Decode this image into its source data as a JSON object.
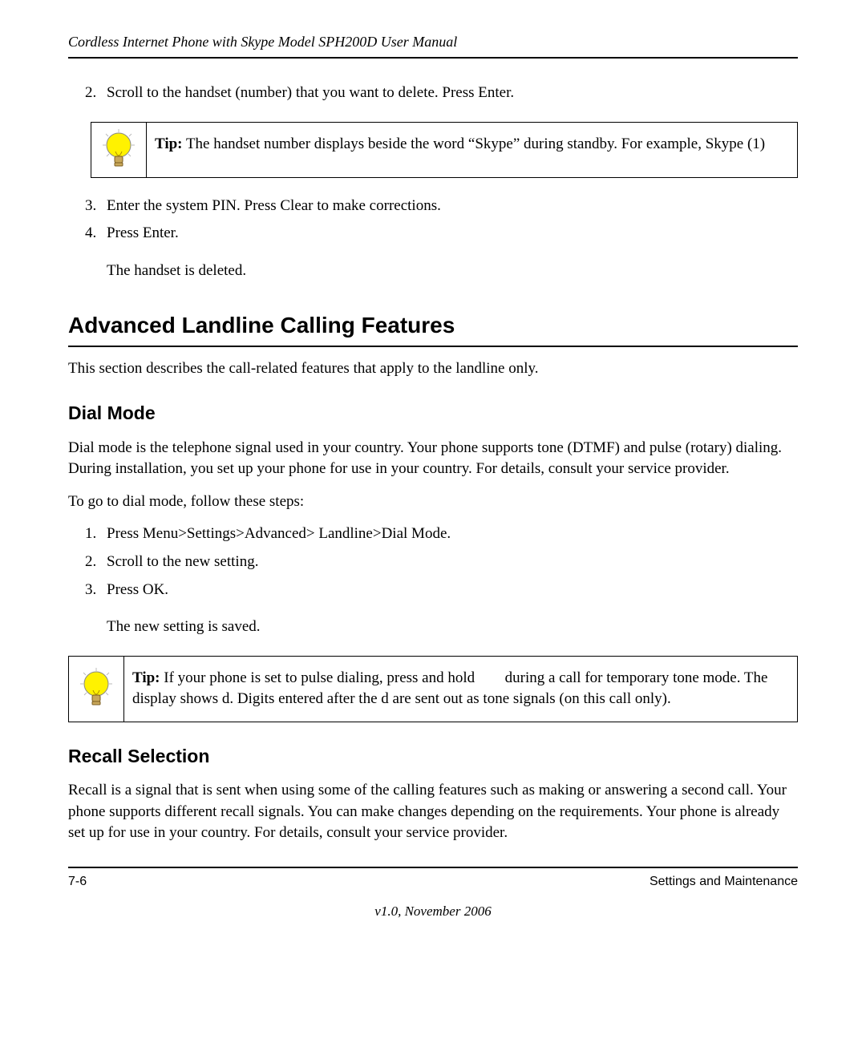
{
  "header": "Cordless Internet Phone with Skype Model SPH200D User Manual",
  "steps_a": {
    "start": 2,
    "items": [
      "Scroll to the handset (number) that you want to delete. Press Enter."
    ]
  },
  "tip1": {
    "label": "Tip:",
    "text": "The handset number displays beside the word “Skype” during standby. For example, Skype (1)"
  },
  "steps_b": {
    "start": 3,
    "items": [
      "Enter the system PIN. Press Clear to make corrections.",
      "Press Enter."
    ]
  },
  "result_b": "The handset is deleted.",
  "h1": "Advanced Landline Calling Features",
  "intro": "This section describes the call-related features that apply to the landline only.",
  "h2a": "Dial Mode",
  "dialmode_p": "Dial mode is the telephone signal used in your country. Your phone supports tone (DTMF) and pulse (rotary) dialing. During installation, you set up your phone for use in your country. For details, consult your service provider.",
  "dialmode_lead": "To go to dial mode, follow these steps:",
  "steps_c": {
    "start": 1,
    "items": [
      "Press Menu>Settings>Advanced> Landline>Dial Mode.",
      "Scroll to the new setting.",
      "Press OK."
    ]
  },
  "result_c": "The new setting is saved.",
  "tip2": {
    "label": "Tip:",
    "text_a": "If your phone is set to pulse dialing, press and hold ",
    "text_b": " during a call for temporary tone mode. The display shows d. Digits entered after the d are sent out as tone signals (on this call only)."
  },
  "h2b": "Recall Selection",
  "recall_p": "Recall is a signal that is sent when using some of the calling features such as making or answering a second call. Your phone supports different recall signals. You can make changes depending on the requirements. Your phone is already set up for use in your country. For details, consult your service provider.",
  "footer_left": "7-6",
  "footer_right": "Settings and Maintenance",
  "version": "v1.0, November 2006"
}
